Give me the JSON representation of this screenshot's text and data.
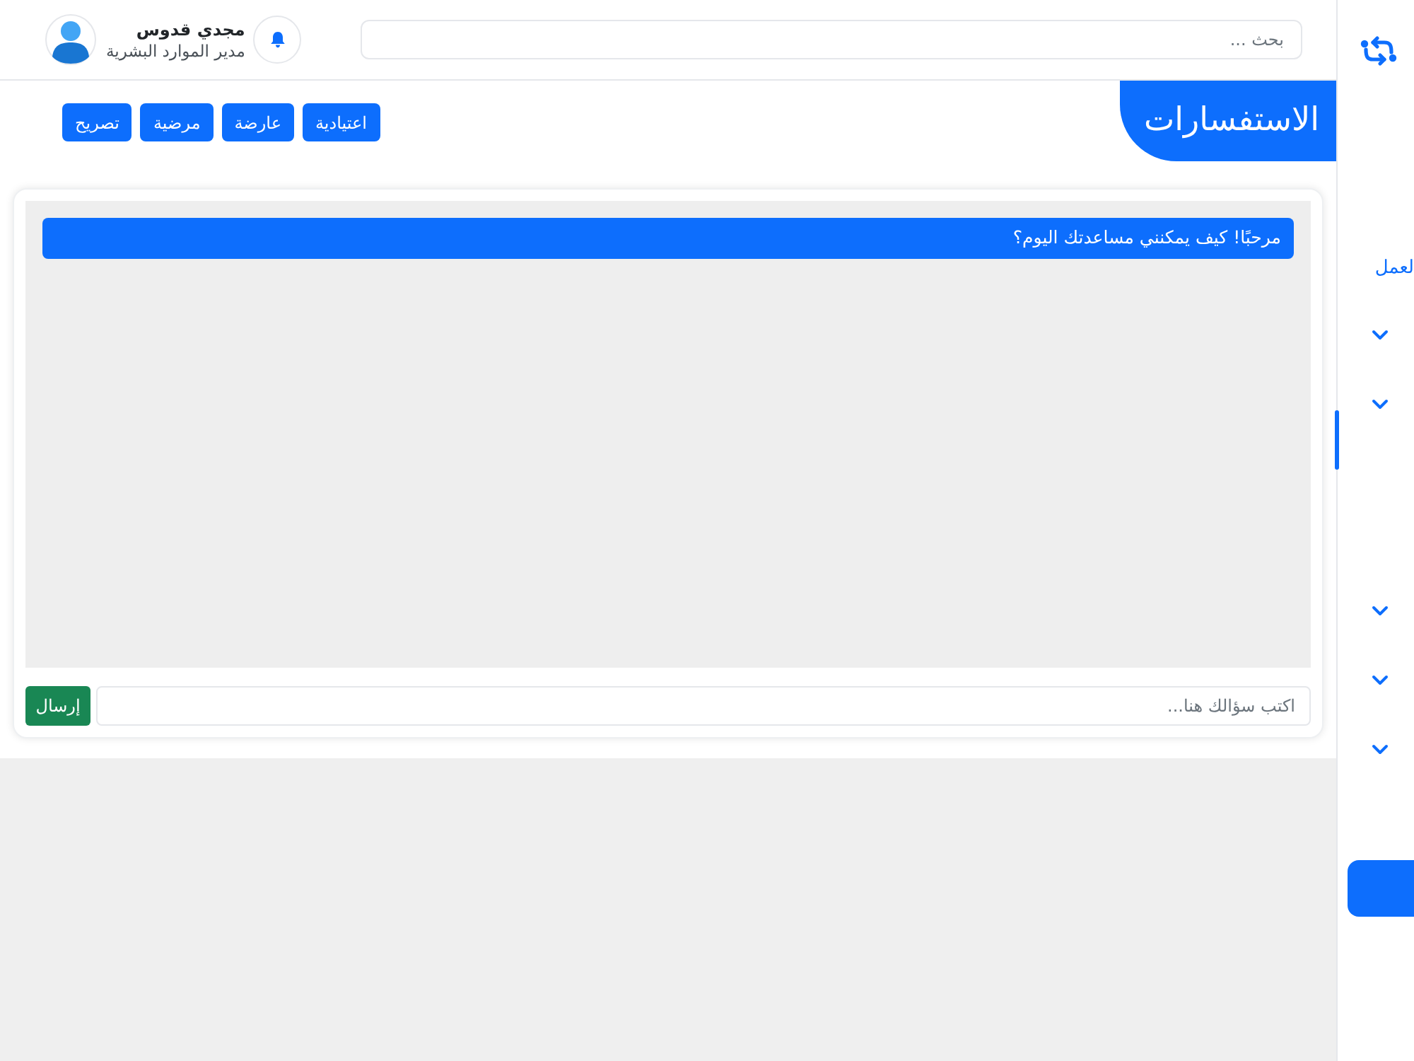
{
  "header": {
    "search": {
      "placeholder": "بحث ..."
    },
    "user": {
      "name": "مجدي قدوس",
      "role": "مدير الموارد البشرية"
    }
  },
  "page": {
    "title": "الاستفسارات",
    "categories": [
      {
        "label": "اعتيادية"
      },
      {
        "label": "عارضة"
      },
      {
        "label": "مرضية"
      },
      {
        "label": "تصريح"
      }
    ]
  },
  "chat": {
    "messages": [
      {
        "text": "مرحبًا! كيف يمكنني مساعدتك اليوم؟"
      }
    ],
    "input": {
      "placeholder": "اكتب سؤالك هنا..."
    },
    "send_button": "إرسال"
  },
  "sidebar": {
    "items": [
      {
        "kind": "link",
        "label": "لعمل",
        "selected": false
      },
      {
        "kind": "group",
        "expanded": false,
        "selected": false
      },
      {
        "kind": "group",
        "expanded": false,
        "selected": true
      },
      {
        "kind": "group",
        "expanded": false,
        "selected": false
      },
      {
        "kind": "group",
        "expanded": false,
        "selected": false
      },
      {
        "kind": "group",
        "expanded": false,
        "selected": false
      }
    ]
  }
}
